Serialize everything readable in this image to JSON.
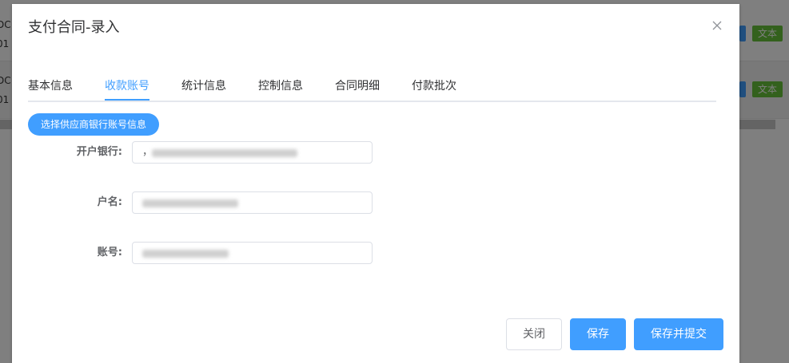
{
  "background": {
    "row1_text": [
      "DC",
      "01"
    ],
    "row2_text": [
      "DC",
      "01"
    ],
    "tag_label": "文本"
  },
  "dialog": {
    "title": "支付合同-录入",
    "close_icon": "close-icon"
  },
  "tabs": [
    {
      "label": "基本信息"
    },
    {
      "label": "收款账号"
    },
    {
      "label": "统计信息"
    },
    {
      "label": "控制信息"
    },
    {
      "label": "合同明细"
    },
    {
      "label": "付款批次"
    }
  ],
  "active_tab": "收款账号",
  "select_bank_button": "选择供应商银行账号信息",
  "form": {
    "bank_label": "开户银行:",
    "bank_value_prefix": "，",
    "name_label": "户名:",
    "account_label": "账号:"
  },
  "footer": {
    "close_label": "关闭",
    "save_label": "保存",
    "submit_label": "保存并提交"
  },
  "colors": {
    "primary": "#409eff",
    "tag_green": "#67c23a"
  }
}
